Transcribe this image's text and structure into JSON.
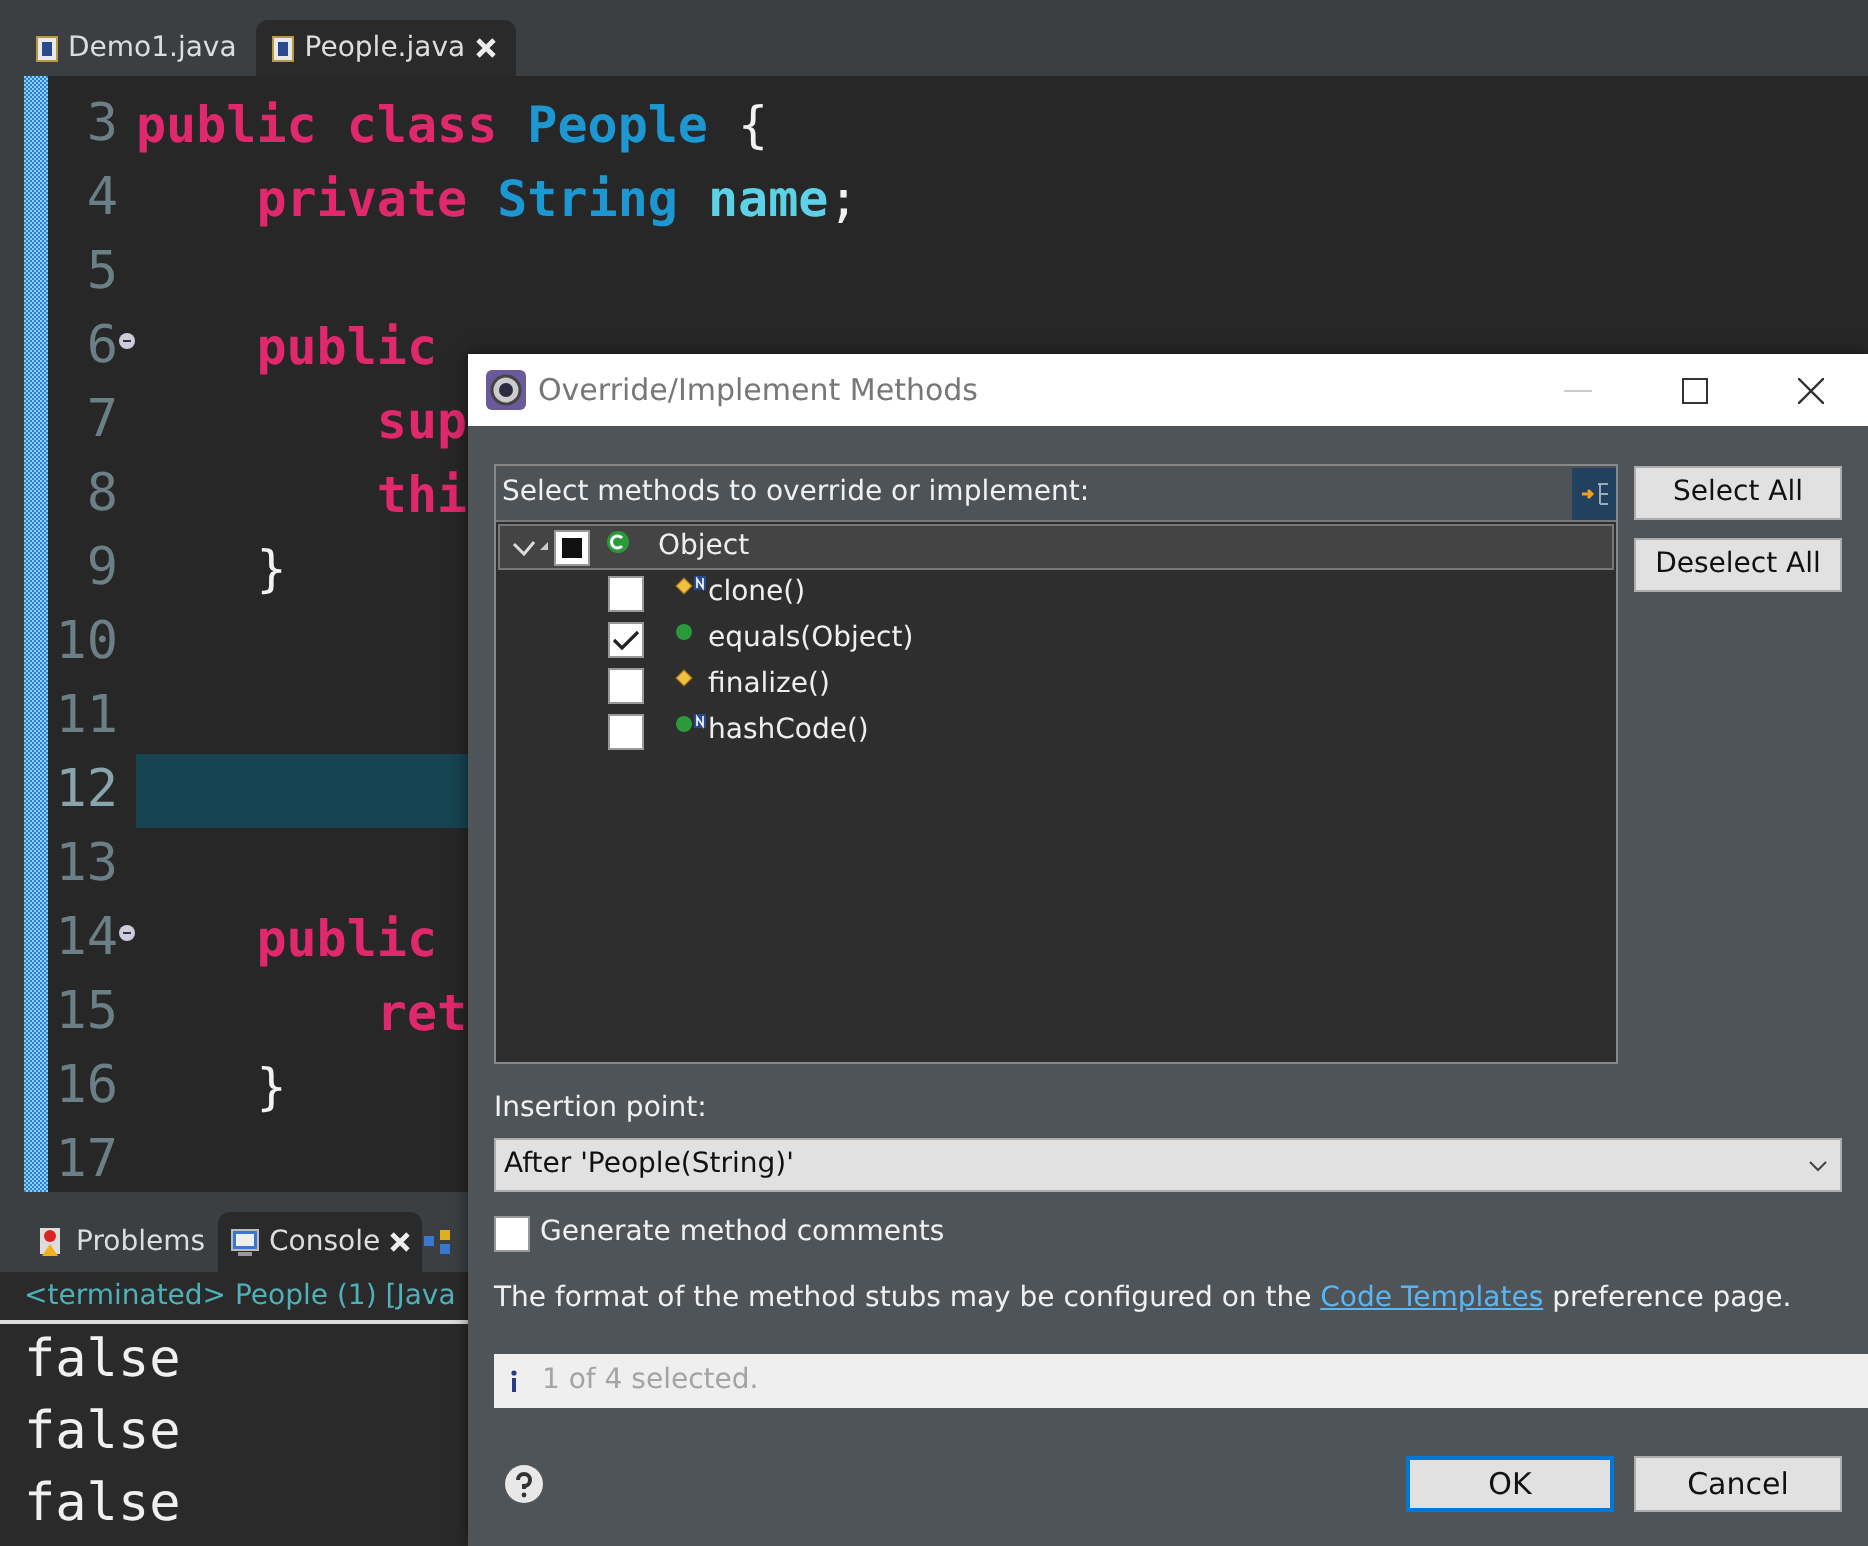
{
  "editor_tabs": [
    {
      "label": "Demo1.java",
      "selected": false,
      "closable": false
    },
    {
      "label": "People.java",
      "selected": true,
      "closable": true
    }
  ],
  "code_lines": [
    {
      "number": "3",
      "fold": false,
      "current": false,
      "tokens": [
        {
          "kind": "keyword",
          "text": "public class "
        },
        {
          "kind": "type",
          "text": "People"
        },
        {
          "kind": "plain",
          "text": " {"
        }
      ]
    },
    {
      "number": "4",
      "fold": false,
      "current": false,
      "tokens": [
        {
          "kind": "keyword",
          "text": "    private "
        },
        {
          "kind": "type",
          "text": "String "
        },
        {
          "kind": "field",
          "text": "name"
        },
        {
          "kind": "plain",
          "text": ";"
        }
      ]
    },
    {
      "number": "5",
      "fold": false,
      "current": false
    },
    {
      "number": "6",
      "fold": true,
      "current": false,
      "tokens": [
        {
          "kind": "keyword",
          "text": "    public"
        }
      ]
    },
    {
      "number": "7",
      "fold": false,
      "current": false,
      "tokens": [
        {
          "kind": "keyword",
          "text": "        sup"
        }
      ]
    },
    {
      "number": "8",
      "fold": false,
      "current": false,
      "tokens": [
        {
          "kind": "keyword",
          "text": "        thi"
        }
      ]
    },
    {
      "number": "9",
      "fold": false,
      "current": false,
      "tokens": [
        {
          "kind": "plain",
          "text": "    }"
        }
      ]
    },
    {
      "number": "10",
      "fold": false,
      "current": false
    },
    {
      "number": "11",
      "fold": false,
      "current": false
    },
    {
      "number": "12",
      "fold": false,
      "current": true
    },
    {
      "number": "13",
      "fold": false,
      "current": false
    },
    {
      "number": "14",
      "fold": true,
      "current": false,
      "tokens": [
        {
          "kind": "keyword",
          "text": "    public"
        }
      ]
    },
    {
      "number": "15",
      "fold": false,
      "current": false,
      "tokens": [
        {
          "kind": "keyword",
          "text": "        ret"
        }
      ]
    },
    {
      "number": "16",
      "fold": false,
      "current": false,
      "tokens": [
        {
          "kind": "plain",
          "text": "    }"
        }
      ]
    },
    {
      "number": "17",
      "fold": false,
      "current": false
    }
  ],
  "bottom_tabs": [
    {
      "label": "Problems",
      "selected": false,
      "closable": false
    },
    {
      "label": "Console",
      "selected": true,
      "closable": true
    }
  ],
  "console": {
    "header": "<terminated> People (1) [Java",
    "lines": [
      "false",
      "false",
      "false"
    ]
  },
  "dialog": {
    "title": "Override/Implement Methods",
    "list_label": "Select methods to override or implement:",
    "tree": [
      {
        "label": "Object",
        "expanded": true,
        "checked": false,
        "mixed": true,
        "selected": true,
        "children": [
          {
            "label": "clone()",
            "checked": false,
            "kind": "protected",
            "native": true
          },
          {
            "label": "equals(Object)",
            "checked": true,
            "kind": "public",
            "native": false
          },
          {
            "label": "finalize()",
            "checked": false,
            "kind": "protected",
            "native": false
          },
          {
            "label": "hashCode()",
            "checked": false,
            "kind": "public",
            "native": true
          }
        ]
      }
    ],
    "side_buttons": [
      "Select All",
      "Deselect All"
    ],
    "insertion_label": "Insertion point:",
    "insertion_value": "After 'People(String)'",
    "generate_comments": {
      "label": "Generate method comments",
      "checked": false
    },
    "note": {
      "before": "The format of the method stubs may be configured on the ",
      "link": "Code Templates",
      "after": " preference page."
    },
    "status": "1 of 4 selected.",
    "buttons": [
      {
        "label": "OK",
        "default": true
      },
      {
        "label": "Cancel",
        "default": false
      }
    ]
  }
}
